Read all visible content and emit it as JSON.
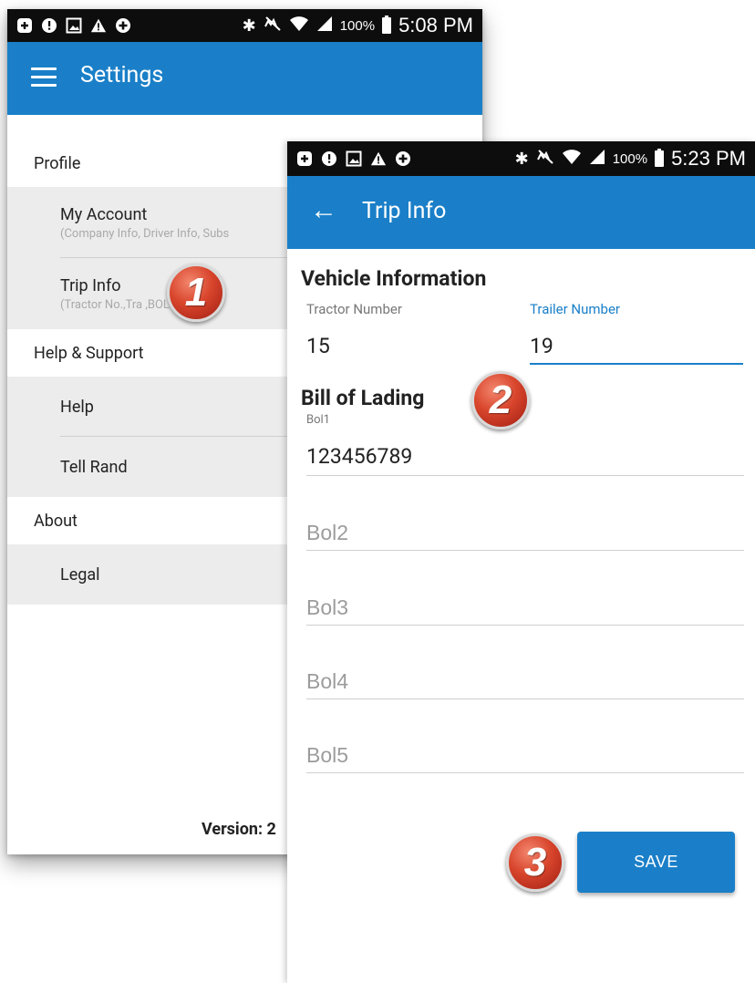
{
  "colors": {
    "app_bar": "#1a7fc8",
    "accent": "#1a7fc8",
    "save_button": "#1a7fc8",
    "badge": "#d8452c"
  },
  "settings_screen": {
    "status_bar": {
      "left_icons": [
        "add-box-icon",
        "info-icon",
        "image-icon",
        "warning-icon",
        "plus-circle-icon"
      ],
      "right_icons": [
        "bluetooth-icon",
        "mute-icon",
        "wifi-icon",
        "signal-icon",
        "battery-icon"
      ],
      "battery": "100%",
      "time": "5:08 PM"
    },
    "title": "Settings",
    "sections": [
      {
        "header": "Profile",
        "items": [
          {
            "label": "My Account",
            "sub": "(Company Info, Driver Info, Subs"
          },
          {
            "label": "Trip Info",
            "sub": "(Tractor No.,Tra      ,BOL No.)"
          }
        ]
      },
      {
        "header": "Help & Support",
        "items": [
          {
            "label": "Help"
          },
          {
            "label": "Tell Rand"
          }
        ]
      },
      {
        "header": "About",
        "items": [
          {
            "label": "Legal"
          }
        ]
      }
    ],
    "version": "Version: 2"
  },
  "trip_screen": {
    "status_bar": {
      "left_icons": [
        "add-box-icon",
        "info-icon",
        "image-icon",
        "warning-icon",
        "plus-circle-icon"
      ],
      "right_icons": [
        "bluetooth-icon",
        "mute-icon",
        "wifi-icon",
        "signal-icon",
        "battery-icon"
      ],
      "battery": "100%",
      "time": "5:23 PM"
    },
    "title": "Trip Info",
    "vehicle": {
      "title": "Vehicle Information",
      "tractor_label": "Tractor Number",
      "tractor_value": "15",
      "trailer_label": "Trailer Number",
      "trailer_value": "19"
    },
    "bol": {
      "title": "Bill of Lading",
      "bol1_label": "Bol1",
      "bol1_value": "123456789",
      "bol2_placeholder": "Bol2",
      "bol3_placeholder": "Bol3",
      "bol4_placeholder": "Bol4",
      "bol5_placeholder": "Bol5"
    },
    "save_label": "SAVE"
  },
  "badges": [
    "1",
    "2",
    "3"
  ]
}
